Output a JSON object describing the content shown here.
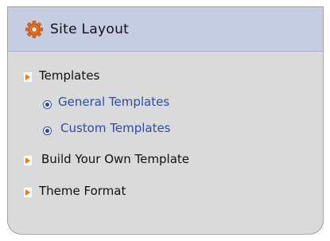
{
  "panel": {
    "title": "Site Layout",
    "title_icon": "gear-icon",
    "accent_color": "#f07a10",
    "link_color": "#2e4ca6"
  },
  "menu": {
    "items": [
      {
        "label": "Templates",
        "level": 0,
        "icon": "arrow-right-icon"
      },
      {
        "label": "General Templates",
        "level": 1,
        "icon": "bullet-icon"
      },
      {
        "label": "Custom Templates",
        "level": 1,
        "icon": "bullet-icon"
      },
      {
        "label": "Build Your Own Template",
        "level": 0,
        "icon": "arrow-right-icon"
      },
      {
        "label": "Theme Format",
        "level": 0,
        "icon": "arrow-right-icon"
      }
    ]
  }
}
